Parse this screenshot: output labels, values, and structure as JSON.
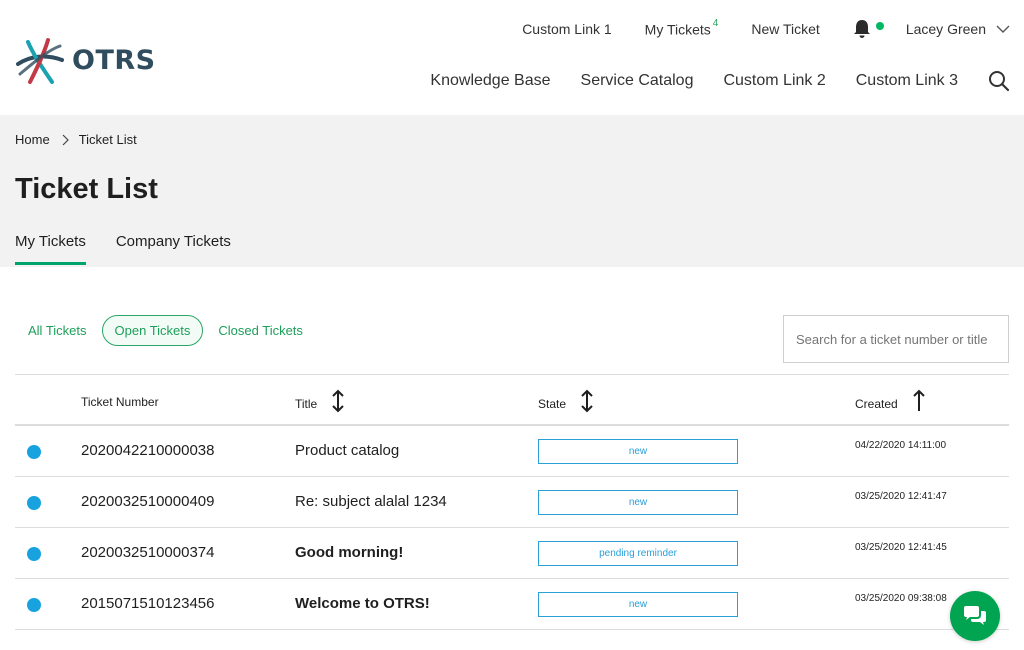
{
  "brand": {
    "name": "OTRS",
    "text_color": "#2f4d5e"
  },
  "topnav": {
    "custom_link_1": "Custom Link 1",
    "my_tickets": "My Tickets",
    "my_tickets_count": "4",
    "new_ticket": "New Ticket",
    "user_name": "Lacey Green"
  },
  "mainnav": {
    "knowledge_base": "Knowledge Base",
    "service_catalog": "Service Catalog",
    "custom_link_2": "Custom Link 2",
    "custom_link_3": "Custom Link 3"
  },
  "breadcrumb": {
    "home": "Home",
    "current": "Ticket List"
  },
  "page": {
    "title": "Ticket List"
  },
  "tabs": [
    {
      "label": "My Tickets",
      "active": true
    },
    {
      "label": "Company Tickets",
      "active": false
    }
  ],
  "filters": [
    {
      "label": "All Tickets",
      "active": false
    },
    {
      "label": "Open Tickets",
      "active": true
    },
    {
      "label": "Closed Tickets",
      "active": false
    }
  ],
  "search": {
    "placeholder": "Search for a ticket number or title"
  },
  "table": {
    "columns": {
      "number": "Ticket Number",
      "title": "Title",
      "state": "State",
      "created": "Created"
    },
    "rows": [
      {
        "number": "2020042210000038",
        "title": "Product catalog",
        "unread": false,
        "state": "new",
        "created": "04/22/2020 14:11:00"
      },
      {
        "number": "2020032510000409",
        "title": "Re: subject alalal 1234",
        "unread": false,
        "state": "new",
        "created": "03/25/2020 12:41:47"
      },
      {
        "number": "2020032510000374",
        "title": "Good morning!",
        "unread": true,
        "state": "pending reminder",
        "created": "03/25/2020 12:41:45"
      },
      {
        "number": "2015071510123456",
        "title": "Welcome to OTRS!",
        "unread": true,
        "state": "new",
        "created": "03/25/2020 09:38:08"
      }
    ]
  },
  "colors": {
    "accent_green": "#00a36c",
    "status_blue": "#18a2e0",
    "chat_green": "#00a451"
  },
  "icons": [
    "otrs-logo-icon",
    "bell-icon",
    "chevron-down-icon",
    "search-icon",
    "breadcrumb-chevron-icon",
    "sort-both-icon",
    "sort-up-icon",
    "chat-icon"
  ]
}
